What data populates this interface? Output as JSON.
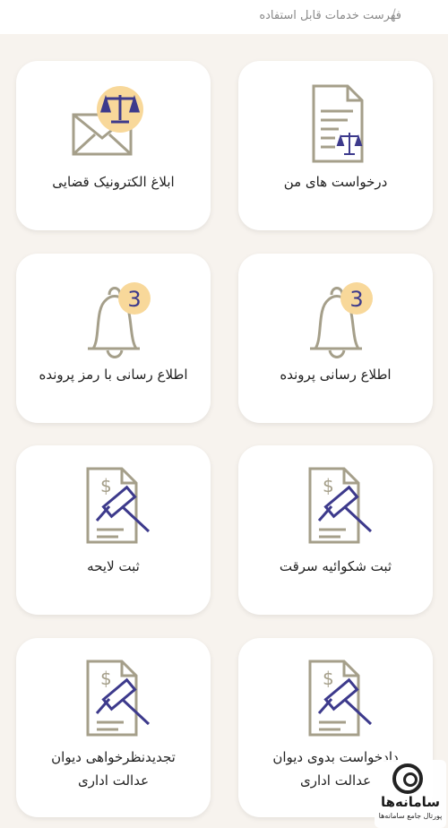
{
  "header": {
    "breadcrumb": "فهرست خدمات قابل استفاده",
    "separator": "/"
  },
  "cards": {
    "my_requests": "درخواست های من",
    "e_notice": "ابلاغ الکترونیک قضایی",
    "case_notify": "اطلاع رسانی پرونده",
    "case_notify_pass": "اطلاع رسانی با رمز پرونده",
    "theft_complaint": "ثبت شکوائیه سرقت",
    "bill": "ثبت لایحه",
    "court_petition_line1": "دادخواست بدوی دیوان",
    "court_petition_line2": "عدالت اداری",
    "court_review_line1": "تجدیدنظرخواهی دیوان",
    "court_review_line2": "عدالت اداری",
    "badge_count": "3"
  },
  "watermark": {
    "title": "سامانه‌ها",
    "subtitle": "پورتال جامع سامانه‌ها"
  },
  "colors": {
    "icon_stroke": "#a59f8a",
    "accent": "#3d3a8c",
    "badge_bg": "#f8d89a",
    "background": "#f7f3ee"
  }
}
